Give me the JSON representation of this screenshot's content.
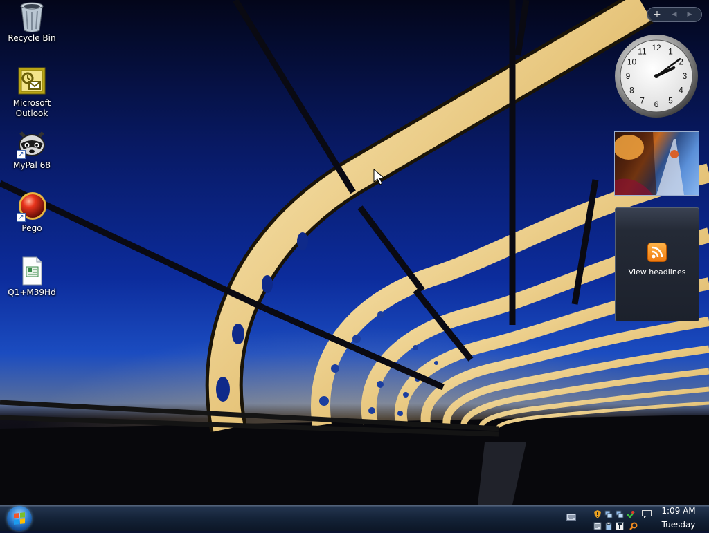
{
  "desktop": {
    "icons": [
      {
        "label": "Recycle Bin",
        "icon": "recycle-bin-icon"
      },
      {
        "label": "Microsoft Outlook",
        "icon": "outlook-icon"
      },
      {
        "label": "MyPal 68",
        "icon": "mypal-raccoon-icon"
      },
      {
        "label": "Pego",
        "icon": "pego-red-ball-icon"
      },
      {
        "label": "Q1+M39Hd",
        "icon": "document-file-icon"
      }
    ]
  },
  "sidebar": {
    "controls": {
      "add": "+",
      "prev": "◀",
      "next": "▶"
    },
    "clock": {
      "hour": 2,
      "minute": 9,
      "numbers": [
        "12",
        "1",
        "2",
        "3",
        "4",
        "5",
        "6",
        "7",
        "8",
        "9",
        "10",
        "11"
      ]
    },
    "slideshow": {
      "description_icon": "photo-slideshow"
    },
    "feed": {
      "label": "View headlines"
    }
  },
  "taskbar": {
    "clock_time": "1:09 AM",
    "clock_day": "Tuesday",
    "tray_icons": [
      "shield-warning-icon",
      "network-icon",
      "network-icon",
      "security-check-icon",
      "action-center-icon",
      "notes-icon",
      "clipboard-icon",
      "text-icon",
      "search-icon"
    ]
  },
  "theme": {
    "taskbar": "#142338",
    "accent": "#2f7fd0",
    "feed": "#f07a10"
  }
}
